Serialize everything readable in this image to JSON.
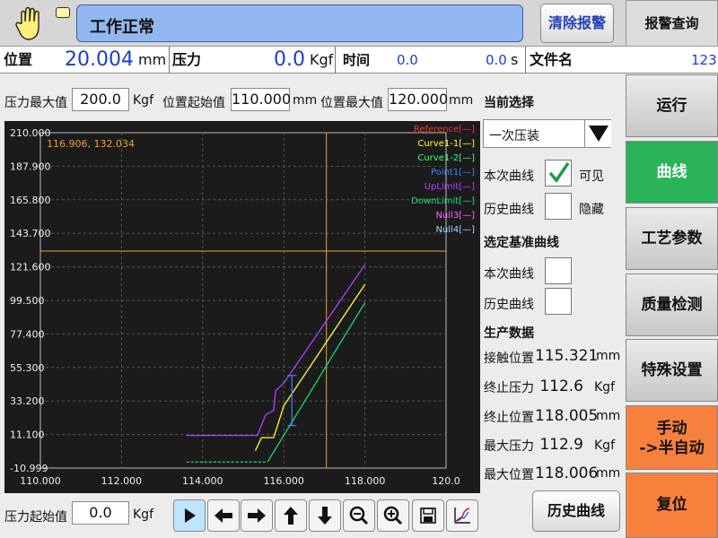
{
  "header": {
    "status_text": "工作正常",
    "clear_alarm_label": "清除报警",
    "alarm_query_label": "报警查询"
  },
  "readout": {
    "position_label": "位置",
    "position_value": "20.004",
    "position_unit": "mm",
    "pressure_label": "压力",
    "pressure_value": "0.0",
    "pressure_unit": "Kgf",
    "time_label": "时间",
    "time_value1": "0.0",
    "time_value2": "0.0",
    "time_unit": "s",
    "file_label": "文件名",
    "file_value": "123"
  },
  "params": {
    "max_pressure_label": "压力最大值",
    "max_pressure_value": "200.0",
    "kgf": "Kgf",
    "pos_start_label": "位置起始值",
    "pos_start_value": "110.000",
    "mm": "mm",
    "pos_max_label": "位置最大值",
    "pos_max_value": "120.000",
    "pressure_start_label": "压力起始值",
    "pressure_start_value": "0.0"
  },
  "chart_data": {
    "type": "line",
    "cursor_readout": "116.906, 132.034",
    "xlim": [
      110,
      120
    ],
    "ylim": [
      -10.999,
      210
    ],
    "x_ticks": [
      "110.000",
      "112.000",
      "114.000",
      "116.000",
      "118.000",
      "120.0"
    ],
    "y_ticks": [
      "210.000",
      "187.900",
      "165.800",
      "143.700",
      "121.600",
      "99.500",
      "77.400",
      "55.300",
      "33.200",
      "11.100",
      "-10.999"
    ],
    "legend": [
      {
        "name": "Reference[—]",
        "color": "#ff3030"
      },
      {
        "name": "Curve1-1[—]",
        "color": "#ffff40"
      },
      {
        "name": "Curve1-2[—]",
        "color": "#40ff80"
      },
      {
        "name": "Point1[—]",
        "color": "#4080ff"
      },
      {
        "name": "UpLimit[—]",
        "color": "#b040ff"
      },
      {
        "name": "DownLimit[—]",
        "color": "#20e080"
      },
      {
        "name": "Null3[—]",
        "color": "#ff60ff"
      },
      {
        "name": "Null4[—]",
        "color": "#a0d8ff"
      }
    ],
    "crosshair": {
      "x": 117.05,
      "y": 132.0
    },
    "series": [
      {
        "color": "#b040ff",
        "points": [
          [
            113.6,
            10.5
          ],
          [
            115.35,
            10.5
          ],
          [
            115.55,
            24
          ],
          [
            115.75,
            27
          ],
          [
            115.8,
            40
          ],
          [
            116.0,
            45
          ],
          [
            118.0,
            123
          ]
        ]
      },
      {
        "color": "#ffff40",
        "points": [
          [
            115.3,
            0.5
          ],
          [
            115.45,
            9
          ],
          [
            115.75,
            9
          ],
          [
            116.0,
            30
          ],
          [
            118.0,
            110
          ]
        ]
      },
      {
        "color": "#20e080",
        "points": [
          [
            113.6,
            -7
          ],
          [
            115.6,
            -7
          ],
          [
            118.0,
            98
          ]
        ],
        "dashed_until": 115.6
      },
      {
        "color": "#4080ff",
        "points": [
          [
            116.2,
            50
          ],
          [
            116.2,
            17
          ]
        ],
        "errorbar": true
      }
    ]
  },
  "right": {
    "current_select_label": "当前选择",
    "select_value": "一次压装",
    "this_curve_label": "本次曲线",
    "visible_label": "可见",
    "history_curve_label": "历史曲线",
    "hidden_label": "隐藏",
    "select_ref_label": "选定基准曲线",
    "ref_this_label": "本次曲线",
    "ref_history_label": "历史曲线",
    "prod_data_label": "生产数据",
    "contact_pos_label": "接触位置",
    "contact_pos_value": "115.321",
    "end_pressure_label": "终止压力",
    "end_pressure_value": "112.6",
    "end_pos_label": "终止位置",
    "end_pos_value": "118.005",
    "max_pressure_label": "最大压力",
    "max_pressure_value": "112.9",
    "max_pos_label": "最大位置",
    "max_pos_value": "118.006",
    "mm": "mm",
    "kgf": "Kgf",
    "history_button_label": "历史曲线"
  },
  "nav": {
    "run": "运行",
    "curve": "曲线",
    "process": "工艺参数",
    "quality": "质量检测",
    "special": "特殊设置",
    "manual": "手动\n->半自动",
    "reset": "复位"
  },
  "colors": {
    "status_blue": "#92b7ef",
    "curve_active": "#2bb35a",
    "orange": "#f7803d"
  }
}
